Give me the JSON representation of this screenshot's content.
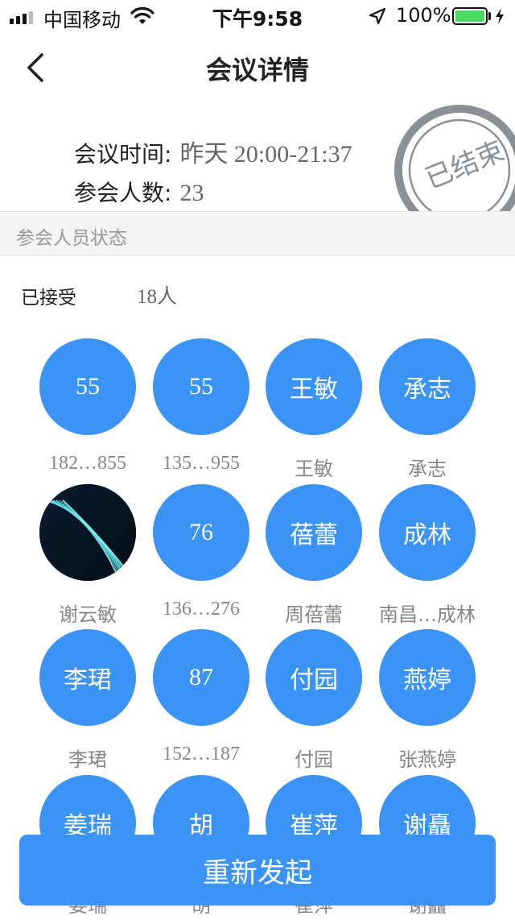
{
  "status_bar": {
    "carrier": "中国移动",
    "time": "下午9:58",
    "battery_percent": "100%",
    "battery_color": "#4cd964"
  },
  "nav": {
    "title": "会议详情",
    "back_icon": "chevron-left-icon"
  },
  "meeting": {
    "time_label": "会议时间:",
    "time_value": "昨天  20:00-21:37",
    "count_label": "参会人数:",
    "count_value": "23",
    "stamp_text": "已结束"
  },
  "section": {
    "title": "参会人员状态"
  },
  "accepted": {
    "label": "已接受",
    "count": "18人"
  },
  "participants": [
    {
      "avatar": "55",
      "name": "182…855"
    },
    {
      "avatar": "55",
      "name": "135…955"
    },
    {
      "avatar": "王敏",
      "name": "王敏"
    },
    {
      "avatar": "承志",
      "name": "承志"
    },
    {
      "avatar": "",
      "name": "谢云敏",
      "photo": true
    },
    {
      "avatar": "76",
      "name": "136…276"
    },
    {
      "avatar": "蓓蕾",
      "name": "周蓓蕾"
    },
    {
      "avatar": "成林",
      "name": "南昌…成林"
    },
    {
      "avatar": "李珺",
      "name": "李珺"
    },
    {
      "avatar": "87",
      "name": "152…187"
    },
    {
      "avatar": "付园",
      "name": "付园"
    },
    {
      "avatar": "燕婷",
      "name": "张燕婷"
    },
    {
      "avatar": "姜瑞",
      "name": "姜瑞"
    },
    {
      "avatar": "胡",
      "name": "胡"
    },
    {
      "avatar": "崔萍",
      "name": "崔萍"
    },
    {
      "avatar": "谢矗",
      "name": "谢矗"
    }
  ],
  "actions": {
    "restart_label": "重新发起"
  },
  "colors": {
    "accent": "#3a93f5",
    "stamp": "#8a9096"
  }
}
